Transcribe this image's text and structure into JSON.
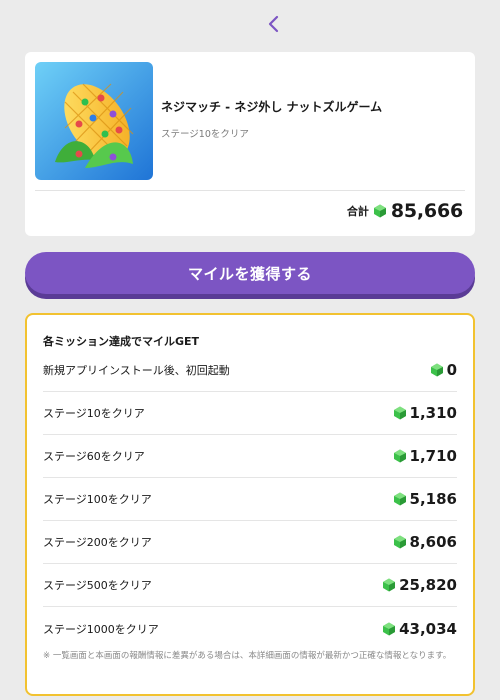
{
  "nav": {
    "back_icon": "chevron-left-icon"
  },
  "colors": {
    "accent": "#7c55c3",
    "highlight_border": "#f2c230",
    "gem": "#3cc14a"
  },
  "app": {
    "icon": "corn-game-icon",
    "name": "ネジマッチ - ネジ外し ナットズルゲーム",
    "subtitle": "ステージ10をクリア"
  },
  "total": {
    "label": "合計",
    "value": "85,666",
    "icon": "gem-icon"
  },
  "cta": {
    "label": "マイルを獲得する"
  },
  "missions": {
    "title": "各ミッション達成でマイルGET",
    "items": [
      {
        "label": "新規アプリインストール後、初回起動",
        "points": "0"
      },
      {
        "label": "ステージ10をクリア",
        "points": "1,310"
      },
      {
        "label": "ステージ60をクリア",
        "points": "1,710"
      },
      {
        "label": "ステージ100をクリア",
        "points": "5,186"
      },
      {
        "label": "ステージ200をクリア",
        "points": "8,606"
      },
      {
        "label": "ステージ500をクリア",
        "points": "25,820"
      },
      {
        "label": "ステージ1000をクリア",
        "points": "43,034"
      }
    ],
    "note": "※ 一覧画面と本画面の報酬情報に差異がある場合は、本詳細画面の情報が最新かつ正確な情報となります。"
  }
}
